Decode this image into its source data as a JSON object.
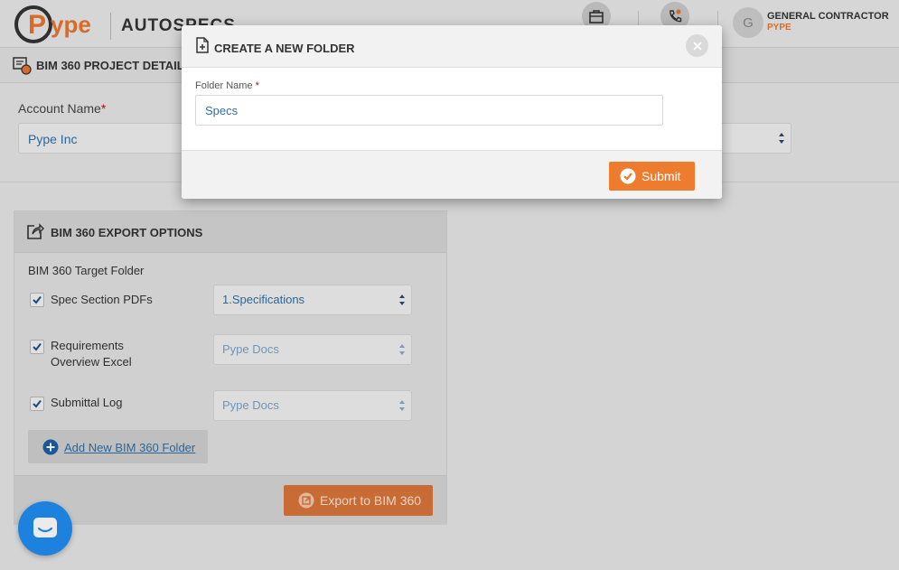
{
  "header": {
    "logo_text": "Pype",
    "app_name": "AUTOSPECS",
    "user_initial": "G",
    "user_name": "GENERAL CONTRACTOR",
    "user_org": "PYPE",
    "icons": [
      "briefcase-icon",
      "phone-icon"
    ]
  },
  "project": {
    "title": "BIM 360 PROJECT DETAILS",
    "account_label": "Account Name",
    "required_mark": "*",
    "account_value": "Pype Inc"
  },
  "export": {
    "title": "BIM 360 EXPORT OPTIONS",
    "target_label": "BIM 360 Target Folder",
    "rows": [
      {
        "label": "Spec Section PDFs",
        "checked": true,
        "folder": "1.Specifications"
      },
      {
        "label": "Requirements Overview Excel",
        "checked": true,
        "folder": "Pype Docs"
      },
      {
        "label": "Submittal Log",
        "checked": true,
        "folder": "Pype Docs"
      }
    ],
    "add_folder_label": "Add New BIM 360 Folder",
    "export_button_label": "Export to BIM 360"
  },
  "modal": {
    "title": "CREATE A NEW FOLDER",
    "folder_label": "Folder Name",
    "required_mark": "*",
    "folder_value": "Specs",
    "submit_label": "Submit"
  },
  "colors": {
    "accent_orange": "#ee7c2f",
    "link_blue": "#2e6fa7",
    "chat_blue": "#1f8ef1"
  }
}
